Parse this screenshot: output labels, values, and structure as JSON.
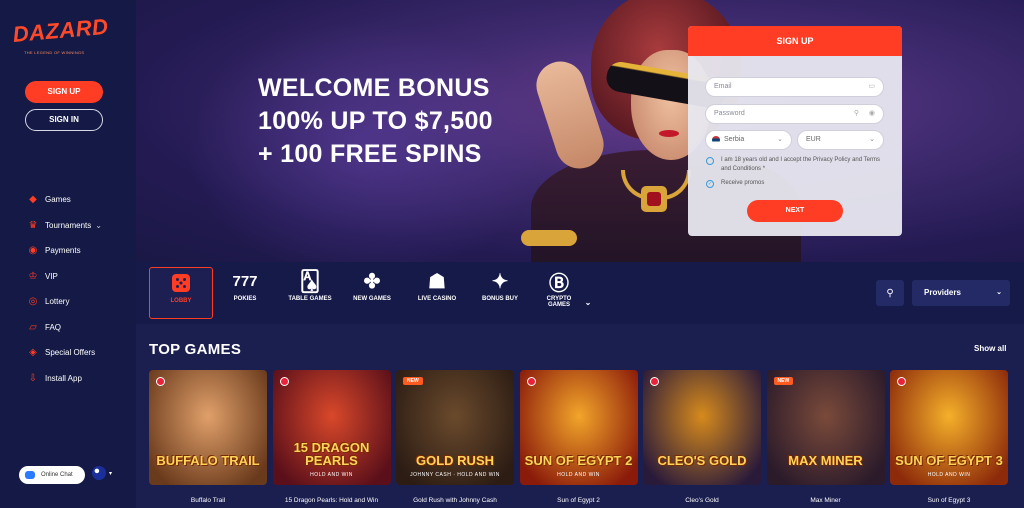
{
  "brand": {
    "name": "DAZARD",
    "tagline": "THE LEGEND OF WINNINGS"
  },
  "sidebar": {
    "signup_label": "SIGN UP",
    "signin_label": "SIGN IN",
    "items": [
      {
        "label": "Games",
        "icon": "dice-icon"
      },
      {
        "label": "Tournaments",
        "icon": "trophy-icon",
        "has_dropdown": true
      },
      {
        "label": "Payments",
        "icon": "coin-icon"
      },
      {
        "label": "VIP",
        "icon": "crown-icon"
      },
      {
        "label": "Lottery",
        "icon": "lottery-ball-icon"
      },
      {
        "label": "FAQ",
        "icon": "chat-icon"
      },
      {
        "label": "Special Offers",
        "icon": "tag-icon"
      },
      {
        "label": "Install App",
        "icon": "download-icon"
      }
    ],
    "online_chat": "Online Chat"
  },
  "hero": {
    "line1": "WELCOME BONUS",
    "line2": "100% UP TO $7,500",
    "line3": "+ 100 FREE SPINS"
  },
  "signup_form": {
    "title": "SIGN UP",
    "email_placeholder": "Email",
    "password_placeholder": "Password",
    "country": "Serbia",
    "currency": "EUR",
    "terms_text": "I am 18 years old and I accept the Privacy Policy and Terms and Conditions *",
    "promos_text": "Receive promos",
    "next_label": "NEXT"
  },
  "categories": [
    {
      "label": "LOBBY",
      "icon": "dice-icon",
      "active": true
    },
    {
      "label": "POKIES",
      "icon": "777-icon"
    },
    {
      "label": "TABLE GAMES",
      "icon": "cards-icon"
    },
    {
      "label": "NEW GAMES",
      "icon": "clover-icon"
    },
    {
      "label": "LIVE CASINO",
      "icon": "live-dealer-icon"
    },
    {
      "label": "BONUS BUY",
      "icon": "ticket-icon"
    },
    {
      "label": "CRYPTO GAMES",
      "icon": "bitcoin-icon"
    }
  ],
  "category_extra": {
    "pokies_icon_text": "777"
  },
  "providers_label": "Providers",
  "top_games": {
    "title": "TOP GAMES",
    "show_all": "Show all",
    "games": [
      {
        "name": "Buffalo Trail",
        "title_art": "BUFFALO TRAIL",
        "subtitle_art": "",
        "badge": "dot",
        "bg1": "#e0a06a",
        "bg2": "#6a3a1c"
      },
      {
        "name": "15 Dragon Pearls: Hold and Win",
        "title_art": "15 DRAGON PEARLS",
        "subtitle_art": "HOLD AND WIN",
        "badge": "dot",
        "bg1": "#d9482a",
        "bg2": "#5a0f1a"
      },
      {
        "name": "Gold Rush with Johnny Cash",
        "title_art": "GOLD RUSH",
        "subtitle_art": "JOHNNY CASH · HOLD AND WIN",
        "badge": "new",
        "bg1": "#6a4a2c",
        "bg2": "#2c1c14"
      },
      {
        "name": "Sun of Egypt 2",
        "title_art": "SUN OF EGYPT 2",
        "subtitle_art": "HOLD AND WIN",
        "badge": "dot",
        "bg1": "#f2a52a",
        "bg2": "#8a1a0a"
      },
      {
        "name": "Cleo's Gold",
        "title_art": "CLEO'S GOLD",
        "subtitle_art": "",
        "badge": "dot",
        "bg1": "#d68a1c",
        "bg2": "#2a1a3a"
      },
      {
        "name": "Max Miner",
        "title_art": "MAX MINER",
        "subtitle_art": "",
        "badge": "new",
        "bg1": "#7a4a3a",
        "bg2": "#2a1a2a"
      },
      {
        "name": "Sun of Egypt 3",
        "title_art": "SUN OF EGYPT 3",
        "subtitle_art": "HOLD AND WIN",
        "badge": "dot",
        "bg1": "#f5b02a",
        "bg2": "#8c2a0a"
      }
    ]
  },
  "colors": {
    "accent": "#ff3d24",
    "sidebar_bg": "#141a45",
    "page_bg": "#1b1f50"
  }
}
